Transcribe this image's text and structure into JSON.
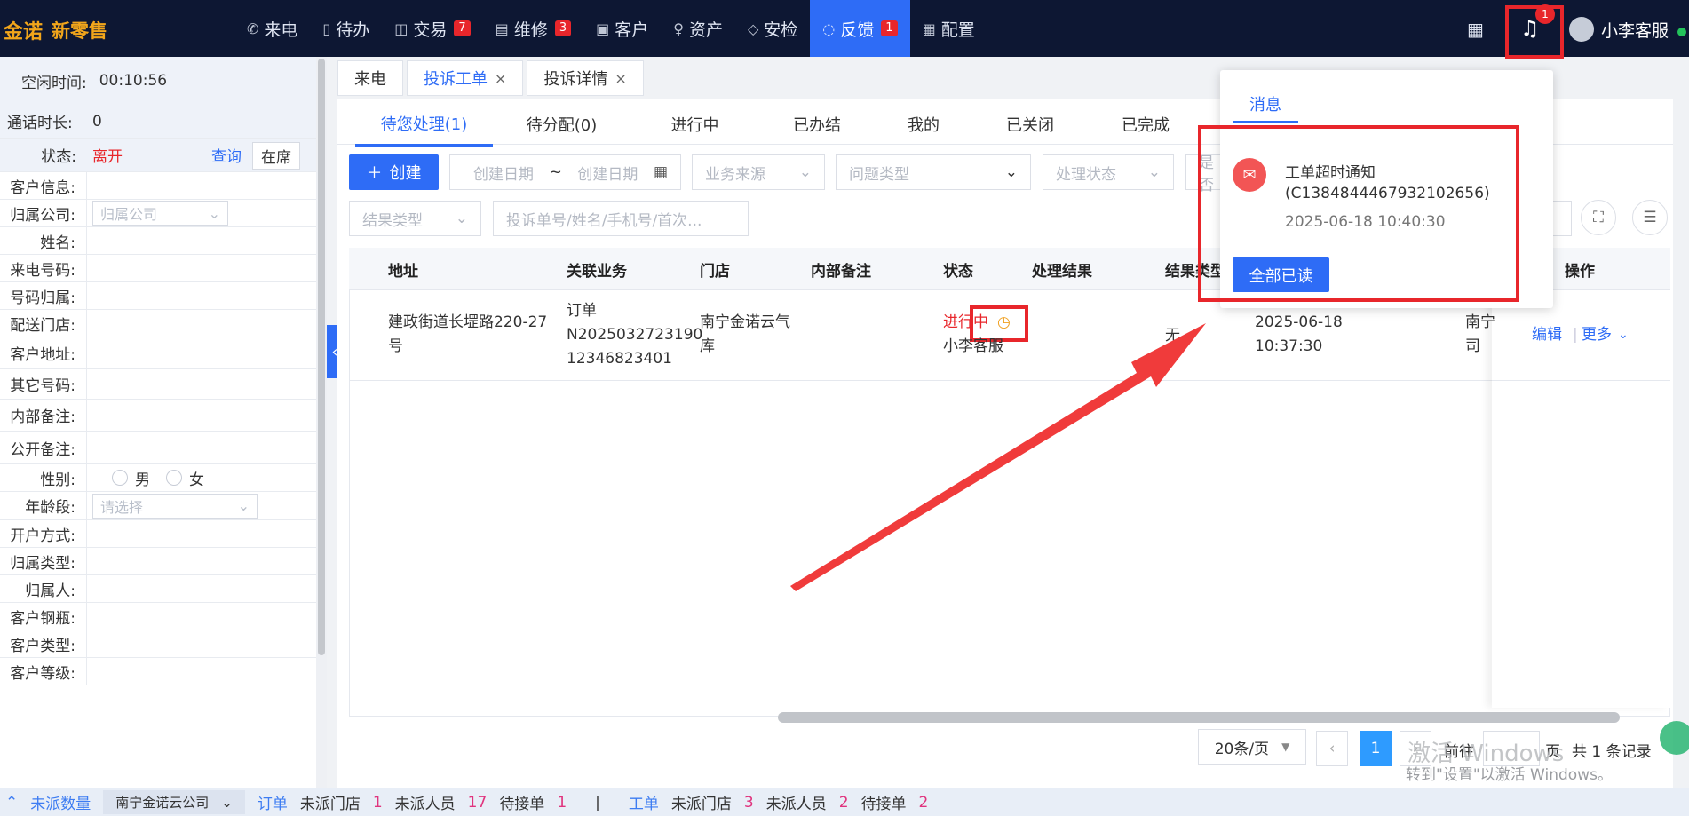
{
  "brand": {
    "logo": "金诺",
    "sub": "新零售"
  },
  "nav": [
    {
      "icon": "phone-icon",
      "glyph": "✆",
      "label": "来电",
      "badge": ""
    },
    {
      "icon": "document-icon",
      "glyph": "▯",
      "label": "待办",
      "badge": ""
    },
    {
      "icon": "bag-icon",
      "glyph": "◫",
      "label": "交易",
      "badge": "7"
    },
    {
      "icon": "clipboard-icon",
      "glyph": "▤",
      "label": "维修",
      "badge": "3"
    },
    {
      "icon": "id-card-icon",
      "glyph": "▣",
      "label": "客户",
      "badge": ""
    },
    {
      "icon": "bulb-icon",
      "glyph": "♀",
      "label": "资产",
      "badge": ""
    },
    {
      "icon": "shield-icon",
      "glyph": "◇",
      "label": "安检",
      "badge": ""
    },
    {
      "icon": "chat-icon",
      "glyph": "◌",
      "label": "反馈",
      "badge": "1"
    },
    {
      "icon": "grid-icon",
      "glyph": "▦",
      "label": "配置",
      "badge": ""
    }
  ],
  "user": {
    "name": "小李客服",
    "bell_count": "1"
  },
  "left": {
    "idle_label": "空闲时间:",
    "idle_value": "00:10:56",
    "call_label": "通话时长:",
    "call_value": "0",
    "status_label": "状态:",
    "status_value": "离开",
    "status_query": "查询",
    "status_btn": "在席",
    "fields": [
      "客户信息:",
      "归属公司:",
      "姓名:",
      "来电号码:",
      "号码归属:",
      "配送门店:",
      "客户地址:",
      "其它号码:",
      "内部备注:",
      "公开备注:",
      "性别:",
      "年龄段:",
      "开户方式:",
      "归属类型:",
      "归属人:",
      "客户钢瓶:",
      "客户类型:",
      "客户等级:"
    ],
    "company_placeholder": "归属公司",
    "gender_male": "男",
    "gender_female": "女",
    "age_placeholder": "请选择"
  },
  "tabs": [
    {
      "label": "来电",
      "closable": false
    },
    {
      "label": "投诉工单",
      "closable": true
    },
    {
      "label": "投诉详情",
      "closable": true
    }
  ],
  "subtabs": [
    "待您处理(1)",
    "待分配(0)",
    "进行中",
    "已办结",
    "我的",
    "已关闭",
    "已完成"
  ],
  "filters": {
    "create": "创建",
    "date_start": "创建日期",
    "date_sep": "~",
    "date_end": "创建日期",
    "source": "业务来源",
    "issue": "问题类型",
    "handle": "处理状态",
    "partial": "是否",
    "result": "结果类型",
    "search": "投诉单号/姓名/手机号/首次..."
  },
  "table": {
    "headers": [
      "地址",
      "关联业务",
      "门店",
      "内部备注",
      "状态",
      "处理结果",
      "结果类型",
      "操作"
    ],
    "row": {
      "address": "建政街道长堽路220-27号",
      "biz_line1": "订单",
      "biz_line2": "N2025032723190",
      "biz_line3": "12346823401",
      "store": "南宁金诺云气库",
      "status": "进行中",
      "handler": "小李客服",
      "result_type": "无",
      "date": "2025-06-18",
      "time": "10:37:30",
      "company_line1": "南宁",
      "company_line2": "司",
      "edit": "编辑",
      "more": "更多"
    }
  },
  "notification": {
    "tab": "消息",
    "title": "工单超时通知",
    "code": "(C1384844467932102656)",
    "time": "2025-06-18 10:40:30",
    "mark_all": "全部已读"
  },
  "pager": {
    "size": "20条/页",
    "page": "1",
    "goto": "前往",
    "page_unit": "页",
    "total": "共 1 条记录"
  },
  "watermark": {
    "line1": "激活 Windows",
    "line2": "转到\"设置\"以激活 Windows。"
  },
  "bottom": {
    "toggle": "未派数量",
    "company": "南宁金诺云公司",
    "order": "订单",
    "unassigned_store": "未派门店",
    "o_store": "1",
    "unassigned_person": "未派人员",
    "o_person": "17",
    "pending": "待接单",
    "o_pending": "1",
    "sep": "|",
    "workorder": "工单",
    "w_store": "3",
    "w_person": "2",
    "w_pending": "2"
  }
}
